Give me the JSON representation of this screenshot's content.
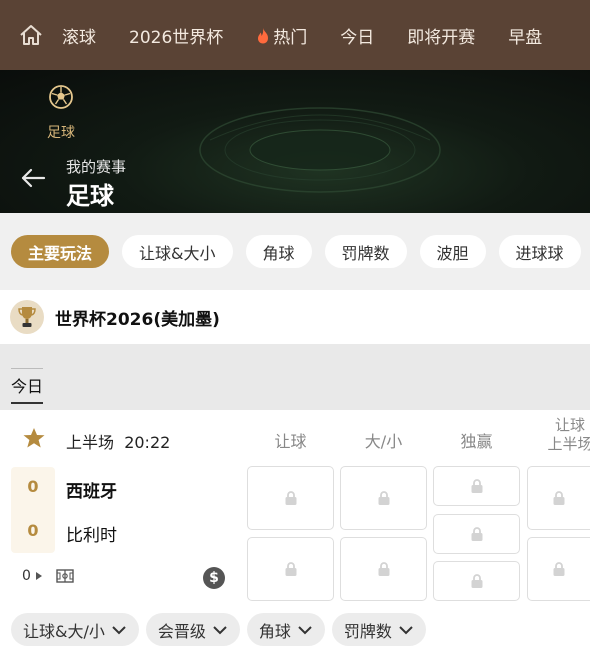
{
  "topnav": {
    "items": [
      {
        "label": "滚球"
      },
      {
        "label": "2026世界杯"
      },
      {
        "label": "热门",
        "icon": "fire-icon"
      },
      {
        "label": "今日"
      },
      {
        "label": "即将开赛"
      },
      {
        "label": "早盘"
      }
    ]
  },
  "hero": {
    "sport_tab": "足球",
    "subtitle": "我的赛事",
    "title": "足球"
  },
  "filters": {
    "chips": [
      "主要玩法",
      "让球&大小",
      "角球",
      "罚牌数",
      "波胆",
      "进球球"
    ],
    "active": "主要玩法"
  },
  "league": {
    "name": "世界杯2026(美加墨)"
  },
  "date_tab": "今日",
  "match": {
    "period": "上半场",
    "clock": "20:22",
    "columns": [
      "让球",
      "大/小",
      "独赢"
    ],
    "column4_line1": "让球",
    "column4_line2": "上半场",
    "home": {
      "name": "西班牙",
      "score": "0"
    },
    "away": {
      "name": "比利时",
      "score": "0"
    },
    "footer_count": "0",
    "currency_badge": "$",
    "market_chips": [
      "让球&大/小",
      "会晋级",
      "角球",
      "罚牌数"
    ]
  },
  "colors": {
    "nav_bg": "#5a4335",
    "accent_gold": "#b58b3f"
  }
}
